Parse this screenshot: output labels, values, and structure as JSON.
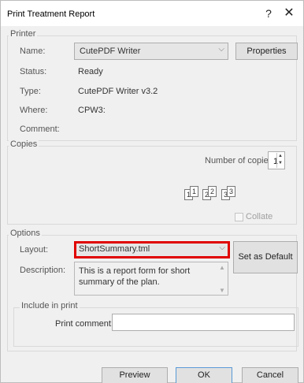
{
  "window": {
    "title": "Print Treatment Report",
    "help_glyph": "?",
    "close_glyph": "✕"
  },
  "printer": {
    "group_label": "Printer",
    "name_label": "Name:",
    "name_value": "CutePDF Writer",
    "properties_label": "Properties",
    "status_label": "Status:",
    "status_value": "Ready",
    "type_label": "Type:",
    "type_value": "CutePDF Writer v3.2",
    "where_label": "Where:",
    "where_value": "CPW3:",
    "comment_label": "Comment:",
    "comment_value": ""
  },
  "copies": {
    "group_label": "Copies",
    "number_label": "Number of copies:",
    "number_value": "1",
    "collate_label": "Collate",
    "collate_checked": false,
    "pages": [
      "1",
      "1",
      "2",
      "2",
      "3",
      "3"
    ]
  },
  "options": {
    "group_label": "Options",
    "layout_label": "Layout:",
    "layout_value": "ShortSummary.tml",
    "set_default_label": "Set as Default",
    "description_label": "Description:",
    "description_value": "This is a report form for short summary of the plan.",
    "include_group_label": "Include in print",
    "print_comment_label": "Print comment:",
    "print_comment_value": ""
  },
  "footer": {
    "preview_label": "Preview",
    "ok_label": "OK",
    "cancel_label": "Cancel"
  },
  "icons": {
    "chevron": "⌵",
    "spin_up": "▲",
    "spin_down": "▼"
  }
}
